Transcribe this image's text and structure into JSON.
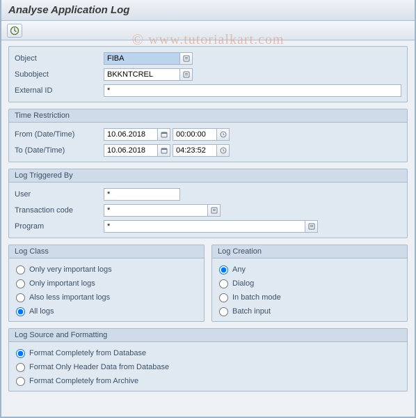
{
  "title": "Analyse Application Log",
  "watermark": "www.tutorialkart.com",
  "sections": {
    "obj": {
      "object_lbl": "Object",
      "object_val": "FIBA",
      "subobject_lbl": "Subobject",
      "subobject_val": "BKKNTCREL",
      "extid_lbl": "External ID",
      "extid_val": "*"
    },
    "time": {
      "legend": "Time Restriction",
      "from_lbl": "From (Date/Time)",
      "from_date": "10.06.2018",
      "from_time": "00:00:00",
      "to_lbl": "To (Date/Time)",
      "to_date": "10.06.2018",
      "to_time": "04:23:52"
    },
    "trig": {
      "legend": "Log Triggered By",
      "user_lbl": "User",
      "user_val": "*",
      "tcode_lbl": "Transaction code",
      "tcode_val": "*",
      "prog_lbl": "Program",
      "prog_val": "*"
    },
    "class": {
      "legend": "Log Class",
      "opts": {
        "very": "Only very important logs",
        "imp": "Only important logs",
        "less": "Also less important logs",
        "all": "All logs"
      },
      "selected": "all"
    },
    "creation": {
      "legend": "Log Creation",
      "opts": {
        "any": "Any",
        "dialog": "Dialog",
        "batch": "In batch mode",
        "batchin": "Batch input"
      },
      "selected": "any"
    },
    "source": {
      "legend": "Log Source and Formatting",
      "opts": {
        "db": "Format Completely from Database",
        "hdr": "Format Only Header Data from Database",
        "arc": "Format Completely from Archive"
      },
      "selected": "db"
    }
  }
}
